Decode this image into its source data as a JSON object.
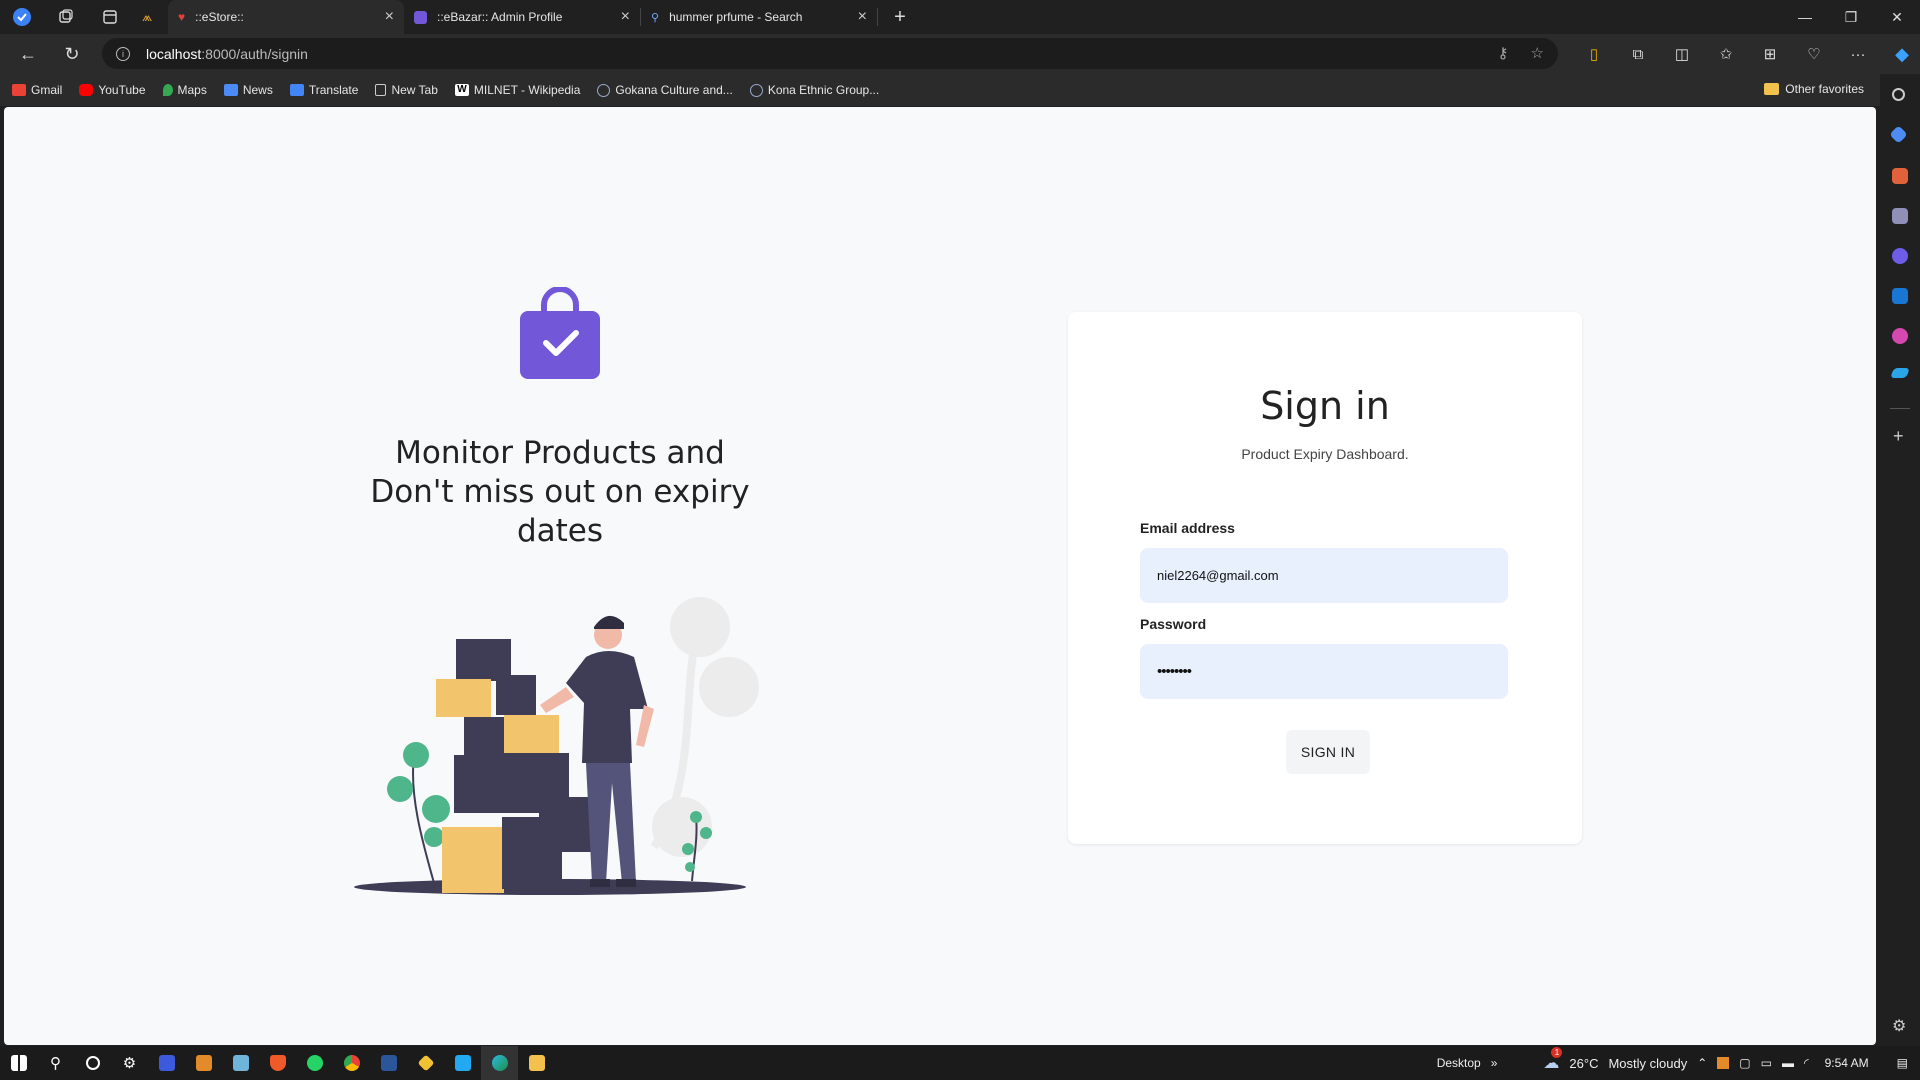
{
  "browser": {
    "tabs": [
      {
        "label": "::eStore::",
        "active": true
      },
      {
        "label": "::eBazar:: Admin Profile",
        "active": false
      },
      {
        "label": "hummer prfume - Search",
        "active": false
      }
    ],
    "address": {
      "host": "localhost",
      "path": ":8000/auth/signin"
    },
    "bookmarks": [
      "Gmail",
      "YouTube",
      "Maps",
      "News",
      "Translate",
      "New Tab",
      "MILNET - Wikipedia",
      "Gokana Culture and...",
      "Kona Ethnic Group..."
    ],
    "other_favorites": "Other favorites"
  },
  "hero": {
    "line1": "Monitor Products and",
    "line2": "Don't miss out on expiry",
    "line3": "dates"
  },
  "signin": {
    "title": "Sign in",
    "subtitle": "Product Expiry Dashboard.",
    "email_label": "Email address",
    "email_value": "niel2264@gmail.com",
    "password_label": "Password",
    "password_value": "••••••••",
    "button": "SIGN IN"
  },
  "taskbar": {
    "desktop": "Desktop",
    "weather_temp": "26°C",
    "weather_text": "Mostly cloudy",
    "time": "9:54 AM",
    "weather_badge": "1"
  },
  "colors": {
    "accent": "#7257d8",
    "box": "#f2c46b",
    "dark": "#3f3d56"
  }
}
